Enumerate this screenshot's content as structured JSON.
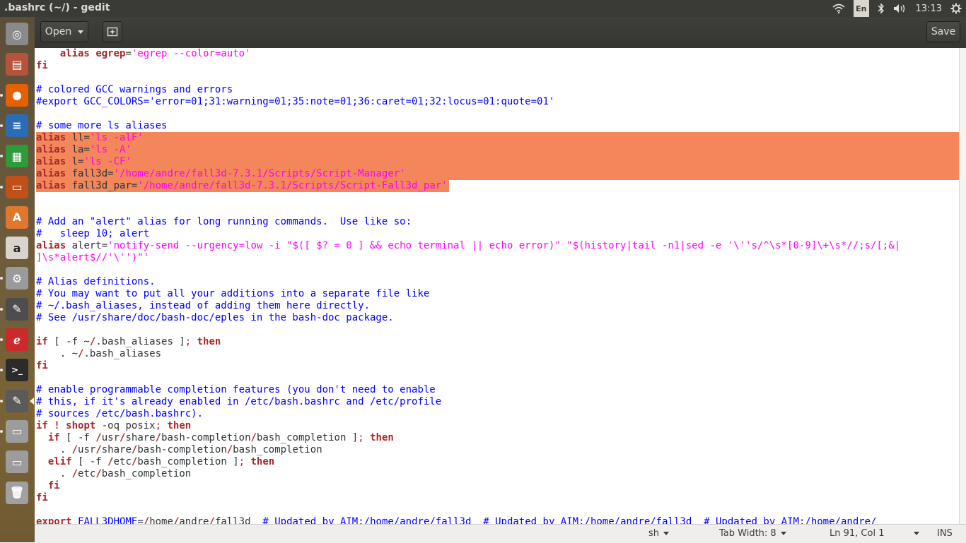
{
  "window": {
    "title": ".bashrc (~/) - gedit"
  },
  "tray": {
    "language": "En",
    "clock": "13:13"
  },
  "toolbar": {
    "open_label": "Open",
    "save_label": "Save"
  },
  "editor": {
    "lines": [
      {
        "segs": [
          {
            "t": "    "
          },
          {
            "t": "alias",
            "c": "kw"
          },
          {
            "t": " "
          },
          {
            "t": "egrep",
            "c": "kw"
          },
          {
            "t": "="
          },
          {
            "t": "'egrep --color=auto'",
            "c": "st"
          }
        ]
      },
      {
        "segs": [
          {
            "t": "fi",
            "c": "kw"
          }
        ]
      },
      {
        "segs": [
          {
            "t": ""
          }
        ]
      },
      {
        "segs": [
          {
            "t": "# colored GCC warnings and errors",
            "c": "cm"
          }
        ]
      },
      {
        "segs": [
          {
            "t": "#export GCC_COLORS='error=01;31:warning=01;35:note=01;36:caret=01;32:locus=01:quote=01'",
            "c": "cm"
          }
        ]
      },
      {
        "segs": [
          {
            "t": ""
          }
        ]
      },
      {
        "segs": [
          {
            "t": "# some more ls aliases",
            "c": "cm"
          }
        ]
      },
      {
        "segs": [
          {
            "t": "alias",
            "c": "kw"
          },
          {
            "t": " ll="
          },
          {
            "t": "'ls -alF'",
            "c": "st"
          }
        ]
      },
      {
        "segs": [
          {
            "t": "alias",
            "c": "kw"
          },
          {
            "t": " la="
          },
          {
            "t": "'ls -A'",
            "c": "st"
          }
        ]
      },
      {
        "segs": [
          {
            "t": "alias",
            "c": "kw"
          },
          {
            "t": " l="
          },
          {
            "t": "'ls -CF'",
            "c": "st"
          }
        ]
      },
      {
        "segs": [
          {
            "t": "alias",
            "c": "kw"
          },
          {
            "t": " fall3d="
          },
          {
            "t": "'/home/andre/fall3d-7.3.1/Scripts/Script-Manager'",
            "c": "st"
          }
        ]
      },
      {
        "segs": [
          {
            "t": "alias",
            "c": "kw"
          },
          {
            "t": " fall3d_par="
          },
          {
            "t": "'/home/andre/fall3d-7.3.1/Scripts/Script-Fall3d_par'",
            "c": "st"
          }
        ]
      },
      {
        "segs": [
          {
            "t": ""
          }
        ]
      },
      {
        "segs": [
          {
            "t": ""
          }
        ]
      },
      {
        "segs": [
          {
            "t": "# Add an \"alert\" alias for long running commands.  Use like so:",
            "c": "cm"
          }
        ]
      },
      {
        "segs": [
          {
            "t": "#   sleep 10; alert",
            "c": "cm"
          }
        ]
      },
      {
        "segs": [
          {
            "t": "alias",
            "c": "kw"
          },
          {
            "t": " alert="
          },
          {
            "t": "'notify-send --urgency=low -i \"$([ $? = 0 ] && echo terminal || echo error)\" \"$(history|tail -n1|sed -e '\\''s/^\\s*[0-9]\\+\\s*//;s/[;&|",
            "c": "st"
          }
        ]
      },
      {
        "segs": [
          {
            "t": "]\\s*alert$//'\\'')\"'",
            "c": "st"
          }
        ]
      },
      {
        "segs": [
          {
            "t": ""
          }
        ]
      },
      {
        "segs": [
          {
            "t": "# Alias definitions.",
            "c": "cm"
          }
        ]
      },
      {
        "segs": [
          {
            "t": "# You may want to put all your additions into a separate file like",
            "c": "cm"
          }
        ]
      },
      {
        "segs": [
          {
            "t": "# ~/.bash_aliases, instead of adding them here directly.",
            "c": "cm"
          }
        ]
      },
      {
        "segs": [
          {
            "t": "# See /usr/share/doc/bash-doc/eples in the bash-doc package.",
            "c": "cm"
          }
        ]
      },
      {
        "segs": [
          {
            "t": ""
          }
        ]
      },
      {
        "segs": [
          {
            "t": "if",
            "c": "kw"
          },
          {
            "t": " [ -f ~"
          },
          {
            "t": "/",
            "c": "kw"
          },
          {
            "t": ".bash_aliases ]"
          },
          {
            "t": ";",
            "c": "op"
          },
          {
            "t": " "
          },
          {
            "t": "then",
            "c": "kw"
          }
        ]
      },
      {
        "segs": [
          {
            "t": "    . ~"
          },
          {
            "t": "/",
            "c": "kw"
          },
          {
            "t": ".bash_aliases"
          }
        ]
      },
      {
        "segs": [
          {
            "t": "fi",
            "c": "kw"
          }
        ]
      },
      {
        "segs": [
          {
            "t": ""
          }
        ]
      },
      {
        "segs": [
          {
            "t": "# enable programmable completion features (you don't need to enable",
            "c": "cm"
          }
        ]
      },
      {
        "segs": [
          {
            "t": "# this, if it's already enabled in /etc/bash.bashrc and /etc/profile",
            "c": "cm"
          }
        ]
      },
      {
        "segs": [
          {
            "t": "# sources /etc/bash.bashrc).",
            "c": "cm"
          }
        ]
      },
      {
        "segs": [
          {
            "t": "if",
            "c": "kw"
          },
          {
            "t": " "
          },
          {
            "t": "!",
            "c": "kw"
          },
          {
            "t": " "
          },
          {
            "t": "shopt",
            "c": "kw"
          },
          {
            "t": " -oq posix"
          },
          {
            "t": ";",
            "c": "op"
          },
          {
            "t": " "
          },
          {
            "t": "then",
            "c": "kw"
          }
        ]
      },
      {
        "segs": [
          {
            "t": "  "
          },
          {
            "t": "if",
            "c": "kw"
          },
          {
            "t": " [ -f "
          },
          {
            "t": "/",
            "c": "kw"
          },
          {
            "t": "usr"
          },
          {
            "t": "/",
            "c": "kw"
          },
          {
            "t": "share"
          },
          {
            "t": "/",
            "c": "kw"
          },
          {
            "t": "bash-completion"
          },
          {
            "t": "/",
            "c": "kw"
          },
          {
            "t": "bash_completion ]"
          },
          {
            "t": ";",
            "c": "op"
          },
          {
            "t": " "
          },
          {
            "t": "then",
            "c": "kw"
          }
        ]
      },
      {
        "segs": [
          {
            "t": "    . "
          },
          {
            "t": "/",
            "c": "kw"
          },
          {
            "t": "usr"
          },
          {
            "t": "/",
            "c": "kw"
          },
          {
            "t": "share"
          },
          {
            "t": "/",
            "c": "kw"
          },
          {
            "t": "bash-completion"
          },
          {
            "t": "/",
            "c": "kw"
          },
          {
            "t": "bash_completion"
          }
        ]
      },
      {
        "segs": [
          {
            "t": "  "
          },
          {
            "t": "elif",
            "c": "kw"
          },
          {
            "t": " [ -f "
          },
          {
            "t": "/",
            "c": "kw"
          },
          {
            "t": "etc"
          },
          {
            "t": "/",
            "c": "kw"
          },
          {
            "t": "bash_completion ]"
          },
          {
            "t": ";",
            "c": "op"
          },
          {
            "t": " "
          },
          {
            "t": "then",
            "c": "kw"
          }
        ]
      },
      {
        "segs": [
          {
            "t": "    . "
          },
          {
            "t": "/",
            "c": "kw"
          },
          {
            "t": "etc"
          },
          {
            "t": "/",
            "c": "kw"
          },
          {
            "t": "bash_completion"
          }
        ]
      },
      {
        "segs": [
          {
            "t": "  "
          },
          {
            "t": "fi",
            "c": "kw"
          }
        ]
      },
      {
        "segs": [
          {
            "t": "fi",
            "c": "kw"
          }
        ]
      },
      {
        "segs": [
          {
            "t": ""
          }
        ]
      },
      {
        "segs": [
          {
            "t": "export",
            "c": "kw"
          },
          {
            "t": " "
          },
          {
            "t": "FALL3DHOME",
            "c": "cm"
          },
          {
            "t": "="
          },
          {
            "t": "/",
            "c": "kw"
          },
          {
            "t": "home"
          },
          {
            "t": "/",
            "c": "kw"
          },
          {
            "t": "andre"
          },
          {
            "t": "/",
            "c": "kw"
          },
          {
            "t": "fall3d  "
          },
          {
            "t": "# Updated by AIM:/home/andre/fall3d  # Updated by AIM:/home/andre/fall3d  # Updated by AIM:/home/andre/",
            "c": "cm"
          }
        ]
      }
    ],
    "selected_line_indices": [
      7,
      8,
      9,
      10,
      11
    ],
    "selected_partial_line_index": 11
  },
  "statusbar": {
    "language": "sh",
    "tab_width": "Tab Width: 8",
    "position": "Ln 91, Col 1",
    "mode": "INS"
  },
  "launcher": {
    "items": [
      {
        "icon": "ubuntu-dash-icon",
        "color": "#8a8a8a"
      },
      {
        "icon": "files-icon",
        "color": "#b5543a"
      },
      {
        "icon": "firefox-icon",
        "color": "#e66000"
      },
      {
        "icon": "libreoffice-writer-icon",
        "color": "#2a6db4"
      },
      {
        "icon": "libreoffice-calc-icon",
        "color": "#2e9a3a"
      },
      {
        "icon": "libreoffice-impress-icon",
        "color": "#c14f18"
      },
      {
        "icon": "software-center-icon",
        "color": "#e0772c"
      },
      {
        "icon": "amazon-icon",
        "color": "#d9d4cc"
      },
      {
        "icon": "system-settings-icon",
        "color": "#9a9a9a"
      },
      {
        "icon": "text-editor-icon",
        "color": "#4d4d4d"
      },
      {
        "icon": "evince-icon",
        "color": "#cc2a2a"
      },
      {
        "icon": "terminal-icon",
        "color": "#2b2b2b"
      },
      {
        "icon": "gedit-icon",
        "color": "#5a5a5a"
      },
      {
        "icon": "drive-icon",
        "color": "#9c9c9c"
      },
      {
        "icon": "drive-icon",
        "color": "#9c9c9c"
      },
      {
        "icon": "trash-icon",
        "color": "#a0a0a0"
      }
    ]
  }
}
